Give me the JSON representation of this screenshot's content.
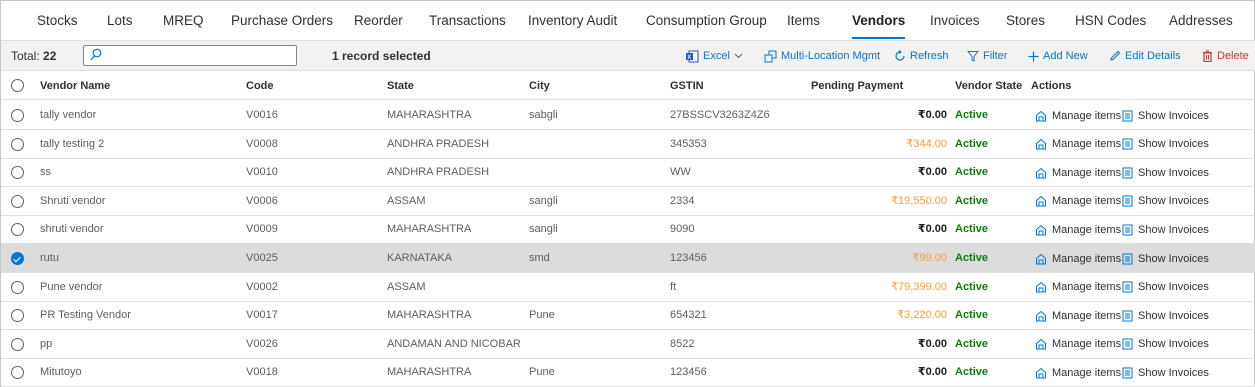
{
  "tabs": [
    {
      "label": "Stocks",
      "active": false
    },
    {
      "label": "Lots",
      "active": false
    },
    {
      "label": "MREQ",
      "active": false
    },
    {
      "label": "Purchase Orders",
      "active": false
    },
    {
      "label": "Reorder",
      "active": false
    },
    {
      "label": "Transactions",
      "active": false
    },
    {
      "label": "Inventory Audit",
      "active": false
    },
    {
      "label": "Consumption Group",
      "active": false
    },
    {
      "label": "Items",
      "active": false
    },
    {
      "label": "Vendors",
      "active": true
    },
    {
      "label": "Invoices",
      "active": false
    },
    {
      "label": "Stores",
      "active": false
    },
    {
      "label": "HSN Codes",
      "active": false
    },
    {
      "label": "Addresses",
      "active": false
    }
  ],
  "toolbar": {
    "total_label": "Total:",
    "total_count": "22",
    "search_value": "",
    "selected_info": "1 record selected",
    "excel_label": "Excel",
    "multi_location_label": "Multi-Location Mgmt",
    "refresh_label": "Refresh",
    "filter_label": "Filter",
    "add_new_label": "Add New",
    "edit_details_label": "Edit Details",
    "delete_label": "Delete"
  },
  "columns": {
    "vendor_name": "Vendor Name",
    "code": "Code",
    "state": "State",
    "city": "City",
    "gstin": "GSTIN",
    "pending_payment": "Pending Payment",
    "vendor_state": "Vendor State",
    "actions": "Actions"
  },
  "actions": {
    "manage_items": "Manage items",
    "show_invoices": "Show Invoices"
  },
  "colors": {
    "accent": "#0078d4",
    "active_status": "#107c10",
    "pending_amount": "#f7a032",
    "delete": "#d13438"
  },
  "rows": [
    {
      "name": "tally vendor",
      "code": "V0016",
      "state": "MAHARASHTRA",
      "city": "sabgli",
      "gstin": "27BSSCV3263Z4Z6",
      "payment": "₹0.00",
      "pending": false,
      "vendor_state": "Active",
      "selected": false
    },
    {
      "name": "tally testing 2",
      "code": "V0008",
      "state": "ANDHRA PRADESH",
      "city": "",
      "gstin": "345353",
      "payment": "₹344.00",
      "pending": true,
      "vendor_state": "Active",
      "selected": false
    },
    {
      "name": "ss",
      "code": "V0010",
      "state": "ANDHRA PRADESH",
      "city": "",
      "gstin": "WW",
      "payment": "₹0.00",
      "pending": false,
      "vendor_state": "Active",
      "selected": false
    },
    {
      "name": "Shruti vendor",
      "code": "V0006",
      "state": "ASSAM",
      "city": "sangli",
      "gstin": "2334",
      "payment": "₹19,550.00",
      "pending": true,
      "vendor_state": "Active",
      "selected": false
    },
    {
      "name": "shruti vendor",
      "code": "V0009",
      "state": "MAHARASHTRA",
      "city": "sangli",
      "gstin": "9090",
      "payment": "₹0.00",
      "pending": false,
      "vendor_state": "Active",
      "selected": false
    },
    {
      "name": "rutu",
      "code": "V0025",
      "state": "KARNATAKA",
      "city": "smd",
      "gstin": "123456",
      "payment": "₹99.00",
      "pending": true,
      "vendor_state": "Active",
      "selected": true
    },
    {
      "name": "Pune vendor",
      "code": "V0002",
      "state": "ASSAM",
      "city": "",
      "gstin": "ft",
      "payment": "₹79,399.00",
      "pending": true,
      "vendor_state": "Active",
      "selected": false
    },
    {
      "name": "PR Testing Vendor",
      "code": "V0017",
      "state": "MAHARASHTRA",
      "city": "Pune",
      "gstin": "654321",
      "payment": "₹3,220.00",
      "pending": true,
      "vendor_state": "Active",
      "selected": false
    },
    {
      "name": "pp",
      "code": "V0026",
      "state": "ANDAMAN AND NICOBAR IS...",
      "city": "",
      "gstin": "8522",
      "payment": "₹0.00",
      "pending": false,
      "vendor_state": "Active",
      "selected": false
    },
    {
      "name": "Mitutoyo",
      "code": "V0018",
      "state": "MAHARASHTRA",
      "city": "Pune",
      "gstin": "123456",
      "payment": "₹0.00",
      "pending": false,
      "vendor_state": "Active",
      "selected": false
    }
  ]
}
